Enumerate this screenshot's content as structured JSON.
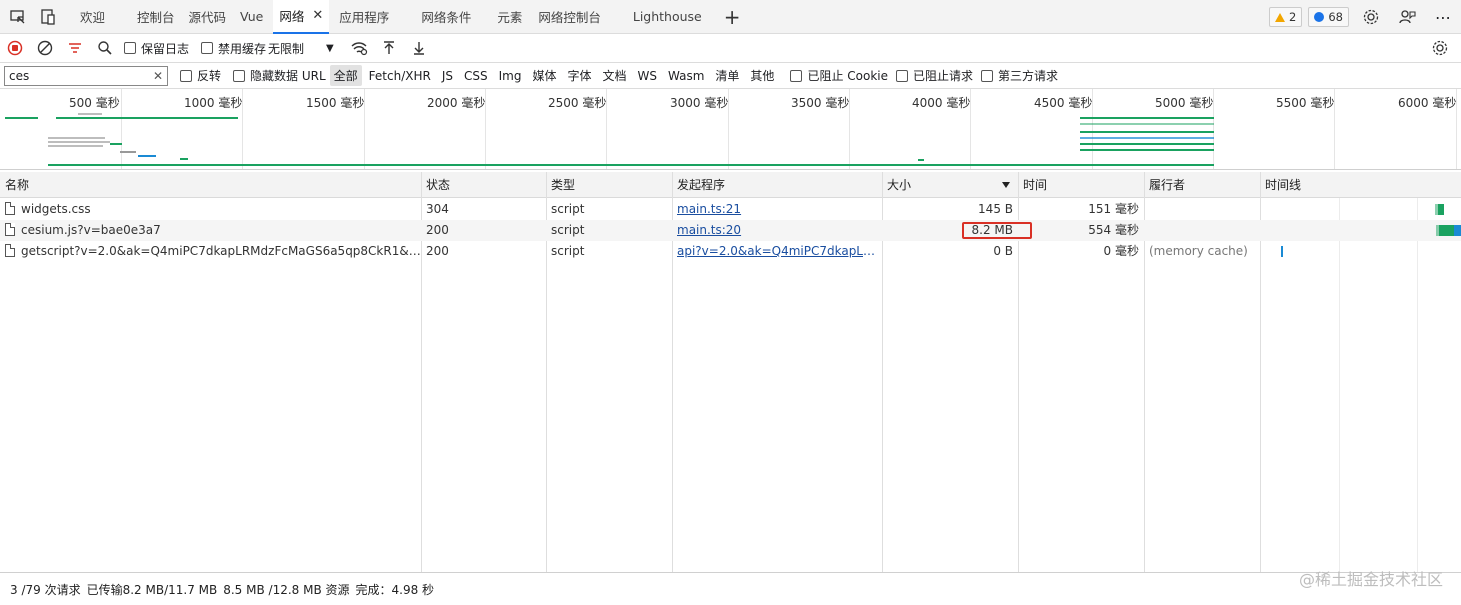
{
  "tabs": [
    "欢迎",
    "控制台",
    "源代码",
    "Vue",
    "网络",
    "应用程序",
    "网络条件",
    "元素",
    "网络控制台",
    "Lighthouse"
  ],
  "active_tab": "网络",
  "badges": {
    "warnings": "2",
    "messages": "68"
  },
  "toolbar": {
    "preserve_log": "保留日志",
    "disable_cache": "禁用缓存",
    "throttle": "无限制"
  },
  "filter": {
    "value": "ces",
    "invert": "反转",
    "hide_data_url": "隐藏数据 URL",
    "types": [
      "全部",
      "Fetch/XHR",
      "JS",
      "CSS",
      "Img",
      "媒体",
      "字体",
      "文档",
      "WS",
      "Wasm",
      "清单",
      "其他"
    ],
    "blocked_cookies": "已阻止 Cookie",
    "blocked_requests": "已阻止请求",
    "third_party": "第三方请求"
  },
  "overview": {
    "ticks": [
      "500  毫秒",
      "1000  毫秒",
      "1500  毫秒",
      "2000  毫秒",
      "2500  毫秒",
      "3000  毫秒",
      "3500  毫秒",
      "4000  毫秒",
      "4500  毫秒",
      "5000  毫秒",
      "5500  毫秒",
      "6000  毫秒"
    ]
  },
  "columns": {
    "name": "名称",
    "status": "状态",
    "type": "类型",
    "initiator": "发起程序",
    "size": "大小",
    "time": "时间",
    "fulfiller": "履行者",
    "waterfall": "时间线"
  },
  "rows": [
    {
      "name": "widgets.css",
      "status": "304",
      "type": "script",
      "initiator": "main.ts:21",
      "size": "145 B",
      "time": "151  毫秒",
      "fulfiller": ""
    },
    {
      "name": "cesium.js?v=bae0e3a7",
      "status": "200",
      "type": "script",
      "initiator": "main.ts:20",
      "size": "8.2 MB",
      "time": "554  毫秒",
      "fulfiller": ""
    },
    {
      "name": "getscript?v=2.0&ak=Q4miPC7dkapLRMdzFcMaGS6a5qp8CkR1&services...",
      "status": "200",
      "type": "script",
      "initiator": "api?v=2.0&ak=Q4miPC7dkapLRMd...",
      "size": "0 B",
      "time": "0  毫秒",
      "fulfiller": "(memory cache)"
    }
  ],
  "status_bar": {
    "requests": "3 /79 次请求",
    "transferred": "已传输8.2 MB/11.7 MB",
    "resources": "8.5 MB /12.8 MB 资源",
    "finish": "完成：4.98 秒"
  },
  "watermark": "@稀土掘金技术社区",
  "colors": {
    "accent": "#1a73e8",
    "highlight": "#d93025",
    "green": "#1aa260",
    "blue": "#1a8ad4"
  }
}
